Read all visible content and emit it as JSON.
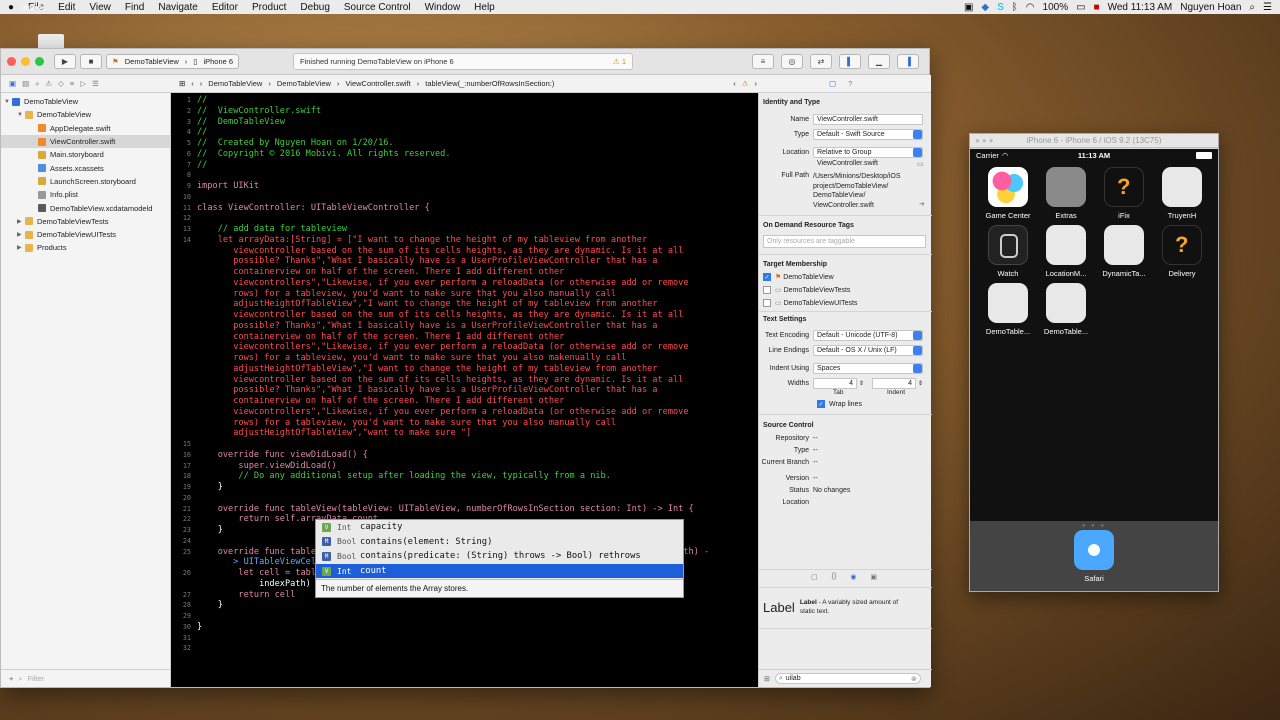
{
  "menubar": {
    "apple": "",
    "app": "Xcode",
    "items": [
      "File",
      "Edit",
      "View",
      "Find",
      "Navigate",
      "Editor",
      "Product",
      "Debug",
      "Source Control",
      "Window",
      "Help"
    ],
    "battery": "100%",
    "clock": "Wed 11:13 AM",
    "user": "Nguyen Hoan"
  },
  "toolbar": {
    "scheme": "DemoTableView",
    "device": "iPhone 6",
    "status": "Finished running DemoTableView on iPhone 6",
    "warnings": "1"
  },
  "jumpbar": [
    "DemoTableView",
    "DemoTableView",
    "ViewController.swift",
    "tableView(_:numberOfRowsInSection:)"
  ],
  "navigator": {
    "items": [
      {
        "label": "DemoTableView",
        "level": 0,
        "type": "project"
      },
      {
        "label": "DemoTableView",
        "level": 1,
        "type": "folder"
      },
      {
        "label": "AppDelegate.swift",
        "level": 2,
        "type": "swift"
      },
      {
        "label": "ViewController.swift",
        "level": 2,
        "type": "swift",
        "selected": true
      },
      {
        "label": "Main.storyboard",
        "level": 2,
        "type": "sb"
      },
      {
        "label": "Assets.xcassets",
        "level": 2,
        "type": "assets"
      },
      {
        "label": "LaunchScreen.storyboard",
        "level": 2,
        "type": "sb"
      },
      {
        "label": "Info.plist",
        "level": 2,
        "type": "plist"
      },
      {
        "label": "DemoTableView.xcdatamodeld",
        "level": 2,
        "type": "data"
      },
      {
        "label": "DemoTableViewTests",
        "level": 1,
        "type": "folder"
      },
      {
        "label": "DemoTableViewUITests",
        "level": 1,
        "type": "folder"
      },
      {
        "label": "Products",
        "level": 1,
        "type": "folder"
      }
    ],
    "filter_placeholder": "Filter"
  },
  "code": {
    "lines": [
      {
        "n": "1",
        "t": "//",
        "c": "cm"
      },
      {
        "n": "2",
        "t": "//  ViewController.swift",
        "c": "cm"
      },
      {
        "n": "3",
        "t": "//  DemoTableView",
        "c": "cm"
      },
      {
        "n": "4",
        "t": "//",
        "c": "cm"
      },
      {
        "n": "5",
        "t": "//  Created by Nguyen Hoan on 1/20/16.",
        "c": "cm"
      },
      {
        "n": "6",
        "t": "//  Copyright © 2016 Mobivi. All rights reserved.",
        "c": "cm"
      },
      {
        "n": "7",
        "t": "//",
        "c": "cm"
      },
      {
        "n": "8",
        "t": "",
        "c": "pl"
      },
      {
        "n": "9",
        "t": "import UIKit",
        "c": "kw"
      },
      {
        "n": "10",
        "t": "",
        "c": "pl"
      },
      {
        "n": "11",
        "t": "class ViewController: UITableViewController {",
        "c": "kw"
      },
      {
        "n": "12",
        "t": "",
        "c": "pl"
      },
      {
        "n": "13",
        "t": "    // add data for tableview",
        "c": "cm"
      },
      {
        "n": "14",
        "t": "    let arrayData:[String] = [\"I want to change the height of my tableview from another",
        "c": "st"
      },
      {
        "n": "",
        "t": "       viewcontroller based on the sum of its cells heights, as they are dynamic. Is it at all",
        "c": "st"
      },
      {
        "n": "",
        "t": "       possible? Thanks\",\"What I basically have is a UserProfileViewController that has a",
        "c": "st"
      },
      {
        "n": "",
        "t": "       containerview on half of the screen. There I add different other",
        "c": "st"
      },
      {
        "n": "",
        "t": "       viewcontrollers\",\"Likewise, if you ever perform a reloadData (or otherwise add or remove",
        "c": "st"
      },
      {
        "n": "",
        "t": "       rows) for a tableview, you'd want to make sure that you also manually call",
        "c": "st"
      },
      {
        "n": "",
        "t": "       adjustHeightOfTableView\",\"I want to change the height of my tableview from another",
        "c": "st"
      },
      {
        "n": "",
        "t": "       viewcontroller based on the sum of its cells heights, as they are dynamic. Is it at all",
        "c": "st"
      },
      {
        "n": "",
        "t": "       possible? Thanks\",\"What I basically have is a UserProfileViewController that has a",
        "c": "st"
      },
      {
        "n": "",
        "t": "       containerview on half of the screen. There I add different other",
        "c": "st"
      },
      {
        "n": "",
        "t": "       viewcontrollers\",\"Likewise, if you ever perform a reloadData (or otherwise add or remove",
        "c": "st"
      },
      {
        "n": "",
        "t": "       rows) for a tableview, you'd want to make sure that you also makenually call",
        "c": "st"
      },
      {
        "n": "",
        "t": "       adjustHeightOfTableView\",\"I want to change the height of my tableview from another",
        "c": "st"
      },
      {
        "n": "",
        "t": "       viewcontroller based on the sum of its cells heights, as they are dynamic. Is it at all",
        "c": "st"
      },
      {
        "n": "",
        "t": "       possible? Thanks\",\"What I basically have is a UserProfileViewController that has a",
        "c": "st"
      },
      {
        "n": "",
        "t": "       containerview on half of the screen. There I add different other",
        "c": "st"
      },
      {
        "n": "",
        "t": "       viewcontrollers\",\"Likewise, if you ever perform a reloadData (or otherwise add or remove",
        "c": "st"
      },
      {
        "n": "",
        "t": "       rows) for a tableview, you'd want to make sure that you also manually call",
        "c": "st"
      },
      {
        "n": "",
        "t": "       adjustHeightOfTableView\",\"want to make sure \"]",
        "c": "st"
      },
      {
        "n": "15",
        "t": "",
        "c": "pl"
      },
      {
        "n": "16",
        "t": "    override func viewDidLoad() {",
        "c": "kw"
      },
      {
        "n": "17",
        "t": "        super.viewDidLoad()",
        "c": "kw"
      },
      {
        "n": "18",
        "t": "        // Do any additional setup after loading the view, typically from a nib.",
        "c": "cm"
      },
      {
        "n": "19",
        "t": "    }",
        "c": "pl"
      },
      {
        "n": "20",
        "t": "",
        "c": "pl"
      },
      {
        "n": "21",
        "t": "    override func tableView(tableView: UITableView, numberOfRowsInSection section: Int) -> Int {",
        "c": "kw"
      },
      {
        "n": "22",
        "t": "        return self.arrayData.count",
        "c": "kw"
      },
      {
        "n": "23",
        "t": "    }",
        "c": "pl"
      },
      {
        "n": "24",
        "t": "",
        "c": "pl"
      },
      {
        "n": "25",
        "t": "    override func tableView(tableView: UITableView, cellForRowAtIndexPath indexPath: NSIndexPath) -",
        "c": "kw"
      },
      {
        "n": "",
        "t": "       > UITableViewCell {",
        "c": "ty"
      },
      {
        "n": "26",
        "t": "        let cell = tableView.dequeueReusableCellWithIdentifier(\"customCell\", forIndexPath:",
        "c": "kw"
      },
      {
        "n": "",
        "t": "            indexPath)",
        "c": "pl"
      },
      {
        "n": "27",
        "t": "        return cell",
        "c": "kw"
      },
      {
        "n": "28",
        "t": "    }",
        "c": "pl"
      },
      {
        "n": "29",
        "t": "",
        "c": "pl"
      },
      {
        "n": "30",
        "t": "}",
        "c": "pl"
      },
      {
        "n": "31",
        "t": "",
        "c": "pl"
      },
      {
        "n": "32",
        "t": "",
        "c": "pl"
      }
    ]
  },
  "autocomplete": {
    "items": [
      {
        "badge": "V",
        "type": "Int",
        "text": "capacity",
        "color": "#6aa84f"
      },
      {
        "badge": "M",
        "type": "Bool",
        "text": "contains(element: String)",
        "color": "#3d5fa8"
      },
      {
        "badge": "M",
        "type": "Bool",
        "text": "contains(predicate: (String) throws -> Bool) rethrows",
        "color": "#3d5fa8"
      },
      {
        "badge": "V",
        "type": "Int",
        "text": "count",
        "color": "#6aa84f",
        "selected": true
      }
    ],
    "description": "The number of elements the Array stores."
  },
  "inspector": {
    "identity_title": "Identity and Type",
    "name_label": "Name",
    "name_value": "ViewController.swift",
    "type_label": "Type",
    "type_value": "Default - Swift Source",
    "location_label": "Location",
    "location_value": "Relative to Group",
    "location_file": "ViewController.swift",
    "fullpath_label": "Full Path",
    "fullpath_value": [
      "/Users/Minions/Desktop/iOS",
      "project/DemoTableView/",
      "DemoTableView/",
      "ViewController.swift"
    ],
    "odr_title": "On Demand Resource Tags",
    "odr_placeholder": "Only resources are taggable",
    "target_title": "Target Membership",
    "targets": [
      {
        "label": "DemoTableView",
        "on": true
      },
      {
        "label": "DemoTableViewTests",
        "on": false
      },
      {
        "label": "DemoTableViewUITests",
        "on": false
      }
    ],
    "text_title": "Text Settings",
    "encoding_label": "Text Encoding",
    "encoding_value": "Default - Unicode (UTF-8)",
    "endings_label": "Line Endings",
    "endings_value": "Default - OS X / Unix (LF)",
    "indent_label": "Indent Using",
    "indent_value": "Spaces",
    "widths_label": "Widths",
    "tab_value": "4",
    "indent_width": "4",
    "tab_caption": "Tab",
    "indent_caption": "Indent",
    "wrap_label": "Wrap lines",
    "sc_title": "Source Control",
    "repo_label": "Repository",
    "repo_value": "--",
    "sctype_label": "Type",
    "sctype_value": "--",
    "branch_label": "Current Branch",
    "branch_value": "--",
    "version_label": "Version",
    "version_value": "--",
    "status_label": "Status",
    "status_value": "No changes",
    "loc_label": "Location",
    "loc_value": "",
    "lib_item_title": "Label",
    "lib_item_bold": "Label",
    "lib_item_desc": " - A variably sized amount of static text.",
    "lib_search": "uilab"
  },
  "simulator": {
    "title": "iPhone 6 - iPhone 6 / iOS 9.2 (13C75)",
    "carrier": "Carrier",
    "time": "11:13 AM",
    "apps": [
      {
        "label": "Game Center",
        "icon": "game-center"
      },
      {
        "label": "Extras",
        "icon": "extras"
      },
      {
        "label": "iFix",
        "icon": "ifix"
      },
      {
        "label": "TruyenH",
        "icon": "grid"
      },
      {
        "label": "Watch",
        "icon": "watch"
      },
      {
        "label": "LocationM...",
        "icon": "grid"
      },
      {
        "label": "DynamicTa...",
        "icon": "grid"
      },
      {
        "label": "Delivery",
        "icon": "delivery"
      },
      {
        "label": "DemoTable...",
        "icon": "grid"
      },
      {
        "label": "DemoTable...",
        "icon": "grid"
      }
    ],
    "dock": [
      {
        "label": "Safari",
        "icon": "safari"
      }
    ]
  }
}
